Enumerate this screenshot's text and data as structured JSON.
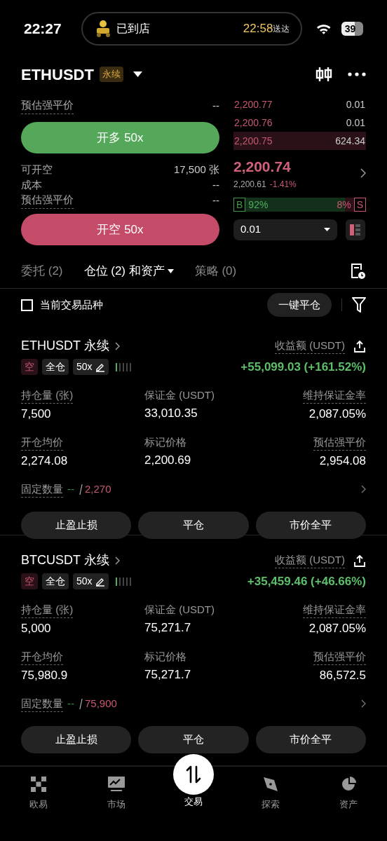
{
  "status_bar": {
    "time": "22:27",
    "activity": {
      "label": "已到店",
      "eta": "22:58",
      "eta_suffix": "送达"
    },
    "battery": "39"
  },
  "header": {
    "symbol": "ETHUSDT",
    "badge": "永续"
  },
  "trade_panel": {
    "top_row": {
      "label": "预估强平价",
      "value": "--"
    },
    "long_button": "开多 50x",
    "info": [
      {
        "label": "可开空",
        "value": "17,500 张",
        "dashed": false
      },
      {
        "label": "成本",
        "value": "--",
        "dashed": false
      },
      {
        "label": "预估强平价",
        "value": "--",
        "dashed": true
      }
    ],
    "short_button": "开空 50x"
  },
  "order_book": {
    "asks": [
      {
        "price": "2,200.77",
        "size": "0.01",
        "highlighted": false
      },
      {
        "price": "2,200.76",
        "size": "0.01",
        "highlighted": false
      },
      {
        "price": "2,200.75",
        "size": "624.34",
        "highlighted": true
      }
    ],
    "last_price": "2,200.74",
    "mark_price": "2,200.61",
    "change": "-1.41%",
    "ratio": {
      "buy_tag": "B",
      "buy": "92%",
      "sell": "8%",
      "sell_tag": "S",
      "level": 0.92
    },
    "depth_select": "0.01"
  },
  "tabs": [
    {
      "label": "委托 (2)",
      "selected": false,
      "has_menu": false
    },
    {
      "label": "仓位 (2) 和资产",
      "selected": true,
      "has_menu": true
    },
    {
      "label": "策略 (0)",
      "selected": false,
      "has_menu": false
    }
  ],
  "filter": {
    "checkbox": {
      "label": "当前交易品种",
      "checked": false
    },
    "close_all_button": "一键平仓"
  },
  "positions": [
    {
      "title": "ETHUSDT 永续",
      "side": "空",
      "margin_mode": "全仓",
      "leverage": "50x",
      "pnl_label": "收益额 (USDT)",
      "pnl": "+55,099.03 (+161.52%)",
      "fields": [
        {
          "label": "持仓量 (张)",
          "value": "7,500",
          "dashed": true
        },
        {
          "label": "保证金 (USDT)",
          "value": "33,010.35",
          "dashed": false
        },
        {
          "label": "维持保证金率",
          "value": "2,087.05%",
          "dashed": true
        },
        {
          "label": "开仓均价",
          "value": "2,274.08",
          "dashed": true
        },
        {
          "label": "标记价格",
          "value": "2,200.69",
          "dashed": false
        },
        {
          "label": "预估强平价",
          "value": "2,954.08",
          "dashed": true
        }
      ],
      "fixed_label": "固定数量",
      "fixed_value": "--",
      "fixed_limit": "2,270",
      "buttons": [
        "止盈止损",
        "平仓",
        "市价全平"
      ]
    },
    {
      "title": "BTCUSDT 永续",
      "side": "空",
      "margin_mode": "全仓",
      "leverage": "50x",
      "pnl_label": "收益额 (USDT)",
      "pnl": "+35,459.46 (+46.66%)",
      "fields": [
        {
          "label": "持仓量 (张)",
          "value": "5,000",
          "dashed": true
        },
        {
          "label": "保证金 (USDT)",
          "value": "75,271.7",
          "dashed": false
        },
        {
          "label": "维持保证金率",
          "value": "2,087.05%",
          "dashed": true
        },
        {
          "label": "开仓均价",
          "value": "75,980.9",
          "dashed": true
        },
        {
          "label": "标记价格",
          "value": "75,271.7",
          "dashed": false
        },
        {
          "label": "预估强平价",
          "value": "86,572.5",
          "dashed": true
        }
      ],
      "fixed_label": "固定数量",
      "fixed_value": "--",
      "fixed_limit": "75,900",
      "buttons": [
        "止盈止损",
        "平仓",
        "市价全平"
      ]
    }
  ],
  "bottom_nav": [
    {
      "label": "欧易",
      "kind": "grid",
      "selected": false
    },
    {
      "label": "市场",
      "kind": "chart",
      "selected": false
    },
    {
      "label": "交易",
      "kind": "trade",
      "selected": true
    },
    {
      "label": "探索",
      "kind": "compass",
      "selected": false
    },
    {
      "label": "资产",
      "kind": "pie",
      "selected": false
    }
  ]
}
